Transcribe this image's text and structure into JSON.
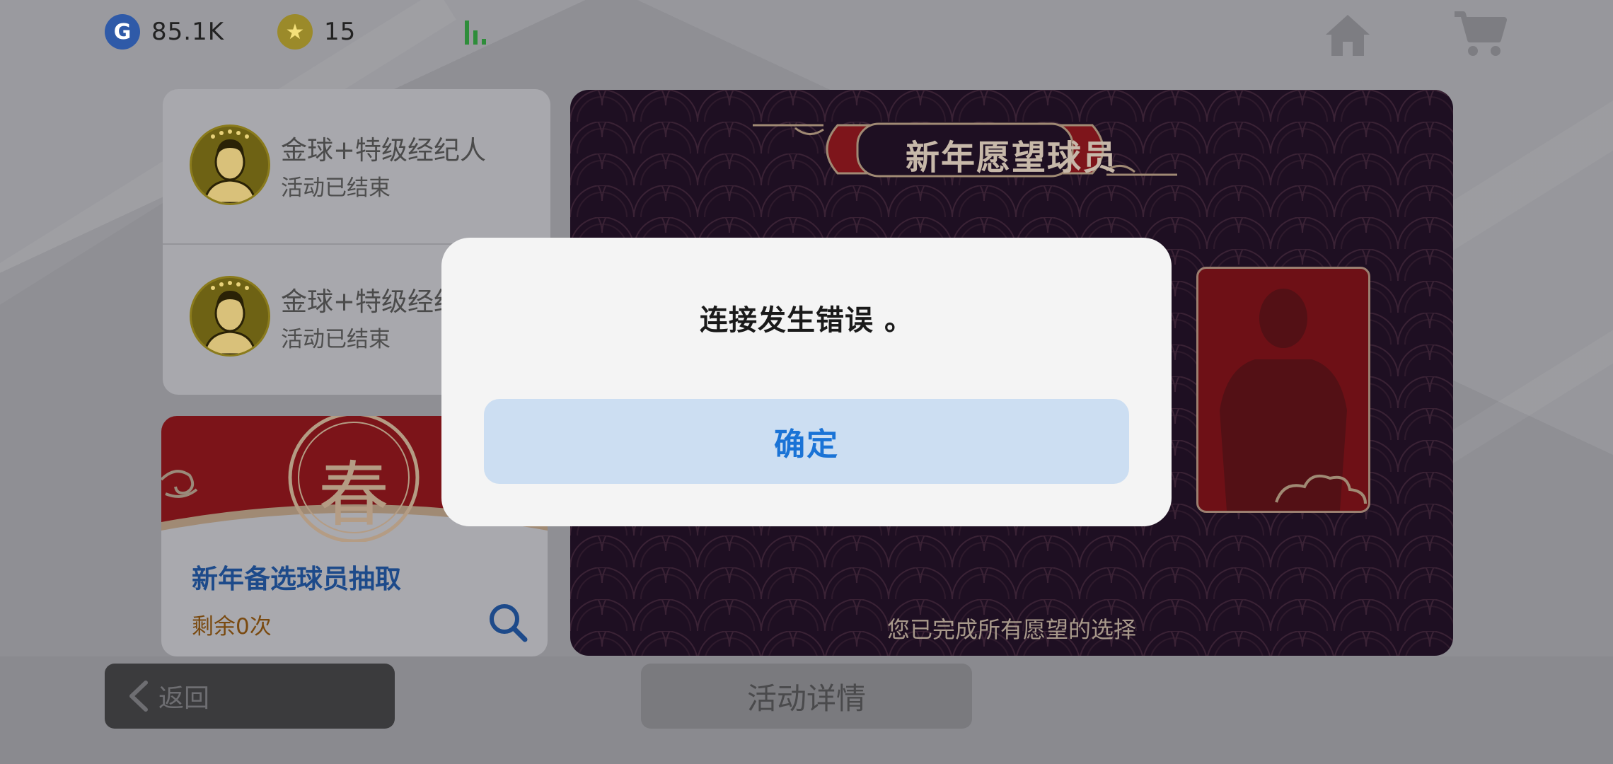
{
  "topbar": {
    "gcoin": {
      "icon": "g-coin-icon",
      "letter": "G",
      "value": "85.1K"
    },
    "stars": {
      "icon": "star-coin-icon",
      "glyph": "★",
      "value": "15"
    },
    "signal_color": "#2e8d3a"
  },
  "events": [
    {
      "title": "金球+特级经纪人",
      "status": "活动已结束"
    },
    {
      "title": "金球+特级经纪人",
      "status": "活动已结束"
    }
  ],
  "draw": {
    "emblem": "春",
    "title": "新年备选球员抽取",
    "remaining": "剩余0次"
  },
  "wish": {
    "title": "新年愿望球员",
    "done_text": "您已完成所有愿望的选择"
  },
  "bottom": {
    "back_label": "返回",
    "detail_label": "活动详情"
  },
  "dialog": {
    "message": "连接发生错误 。",
    "confirm_label": "确定"
  },
  "colors": {
    "panel": "#1e0f22",
    "accent_red": "#8d1a1f",
    "confirm_text": "#1a73d6"
  }
}
